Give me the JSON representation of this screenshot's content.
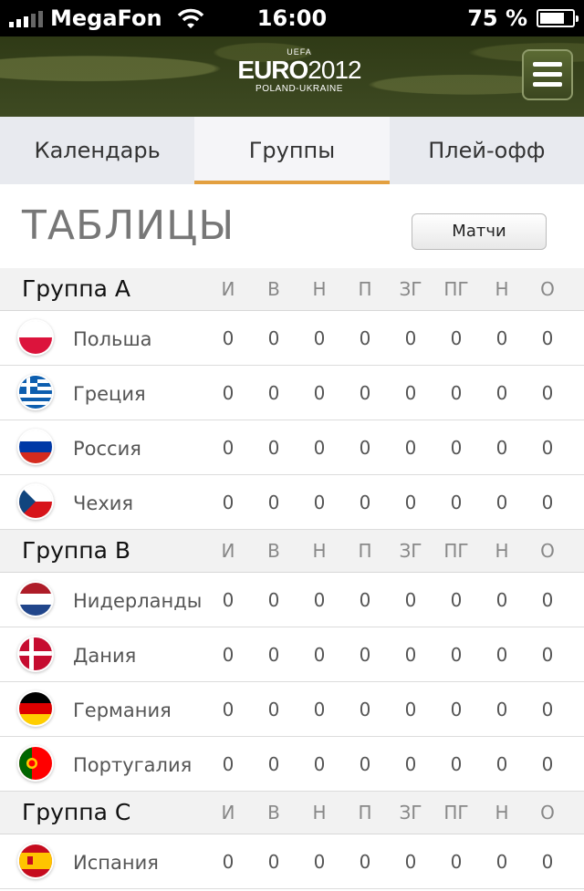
{
  "status_bar": {
    "carrier": "MegaFon",
    "time": "16:00",
    "battery": "75 %",
    "battery_level": 0.75,
    "signal_bars": 3
  },
  "header": {
    "logo_top": "UEFA",
    "logo_euro": "EURO",
    "logo_year": "2012",
    "logo_sub": "POLAND-UKRAINE"
  },
  "tabs": [
    {
      "label": "Календарь"
    },
    {
      "label": "Группы",
      "active": true
    },
    {
      "label": "Плей-офф"
    }
  ],
  "page": {
    "title": "ТАБЛИЦЫ",
    "matches_button": "Матчи"
  },
  "columns": [
    "И",
    "В",
    "Н",
    "П",
    "ЗГ",
    "ПГ",
    "Н",
    "О"
  ],
  "groups": [
    {
      "name": "Группа A",
      "teams": [
        {
          "name": "Польша",
          "flag": "poland-flag",
          "stats": [
            "0",
            "0",
            "0",
            "0",
            "0",
            "0",
            "0",
            "0"
          ]
        },
        {
          "name": "Греция",
          "flag": "greece-flag",
          "stats": [
            "0",
            "0",
            "0",
            "0",
            "0",
            "0",
            "0",
            "0"
          ]
        },
        {
          "name": "Россия",
          "flag": "russia-flag",
          "stats": [
            "0",
            "0",
            "0",
            "0",
            "0",
            "0",
            "0",
            "0"
          ]
        },
        {
          "name": "Чехия",
          "flag": "czech-flag",
          "stats": [
            "0",
            "0",
            "0",
            "0",
            "0",
            "0",
            "0",
            "0"
          ]
        }
      ]
    },
    {
      "name": "Группа B",
      "teams": [
        {
          "name": "Нидерланды",
          "flag": "netherlands-flag",
          "stats": [
            "0",
            "0",
            "0",
            "0",
            "0",
            "0",
            "0",
            "0"
          ]
        },
        {
          "name": "Дания",
          "flag": "denmark-flag",
          "stats": [
            "0",
            "0",
            "0",
            "0",
            "0",
            "0",
            "0",
            "0"
          ]
        },
        {
          "name": "Германия",
          "flag": "germany-flag",
          "stats": [
            "0",
            "0",
            "0",
            "0",
            "0",
            "0",
            "0",
            "0"
          ]
        },
        {
          "name": "Португалия",
          "flag": "portugal-flag",
          "stats": [
            "0",
            "0",
            "0",
            "0",
            "0",
            "0",
            "0",
            "0"
          ]
        }
      ]
    },
    {
      "name": "Группа C",
      "teams": [
        {
          "name": "Испания",
          "flag": "spain-flag",
          "stats": [
            "0",
            "0",
            "0",
            "0",
            "0",
            "0",
            "0",
            "0"
          ]
        }
      ]
    }
  ],
  "colors": {
    "accent": "#e3a040",
    "header_bg": "#3e4a22"
  }
}
